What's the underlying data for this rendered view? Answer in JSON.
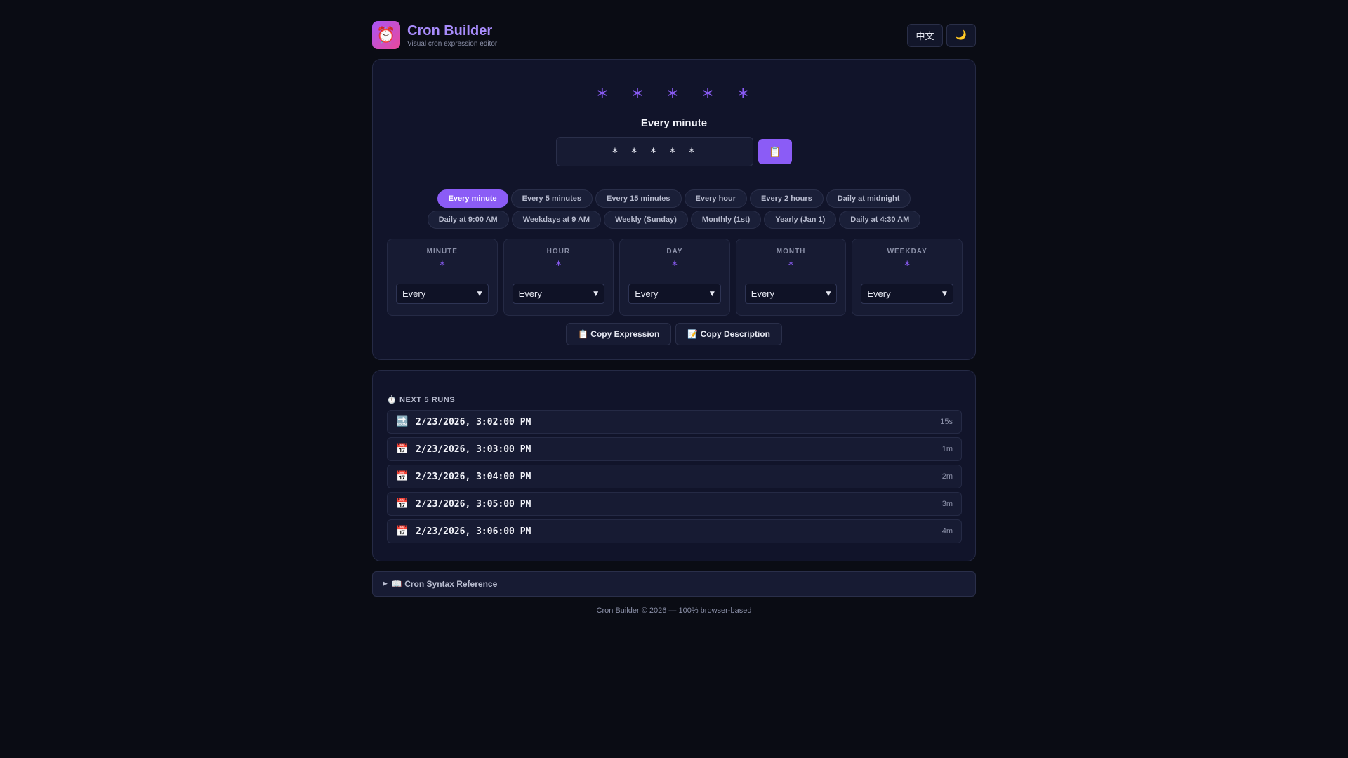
{
  "app": {
    "title": "Cron Builder",
    "subtitle": "Visual cron expression editor",
    "logo_icon": "⏰",
    "lang_label": "中文",
    "theme_icon": "🌙"
  },
  "expression": {
    "display": "* * * * *",
    "description": "Every minute",
    "input_value": "* * * * *",
    "copy_icon": "📋"
  },
  "presets": [
    {
      "label": "Every minute",
      "active": true
    },
    {
      "label": "Every 5 minutes"
    },
    {
      "label": "Every 15 minutes"
    },
    {
      "label": "Every hour"
    },
    {
      "label": "Every 2 hours"
    },
    {
      "label": "Daily at midnight"
    },
    {
      "label": "Daily at 9:00 AM"
    },
    {
      "label": "Weekdays at 9 AM"
    },
    {
      "label": "Weekly (Sunday)"
    },
    {
      "label": "Monthly (1st)"
    },
    {
      "label": "Yearly (Jan 1)"
    },
    {
      "label": "Daily at 4:30 AM"
    }
  ],
  "fields": [
    {
      "label": "MINUTE",
      "value": "*",
      "select": "Every"
    },
    {
      "label": "HOUR",
      "value": "*",
      "select": "Every"
    },
    {
      "label": "DAY",
      "value": "*",
      "select": "Every"
    },
    {
      "label": "MONTH",
      "value": "*",
      "select": "Every"
    },
    {
      "label": "WEEKDAY",
      "value": "*",
      "select": "Every"
    }
  ],
  "actions": {
    "copy_expression": "📋 Copy Expression",
    "copy_description": "📝 Copy Description"
  },
  "runs": {
    "title": "⏱️ NEXT 5 RUNS",
    "items": [
      {
        "icon": "🔜",
        "time": "2/23/2026, 3:02:00 PM",
        "relative": "15s"
      },
      {
        "icon": "📅",
        "time": "2/23/2026, 3:03:00 PM",
        "relative": "1m"
      },
      {
        "icon": "📅",
        "time": "2/23/2026, 3:04:00 PM",
        "relative": "2m"
      },
      {
        "icon": "📅",
        "time": "2/23/2026, 3:05:00 PM",
        "relative": "3m"
      },
      {
        "icon": "📅",
        "time": "2/23/2026, 3:06:00 PM",
        "relative": "4m"
      }
    ]
  },
  "reference": {
    "label": "📖 Cron Syntax Reference"
  },
  "footer": "Cron Builder © 2026 — 100% browser-based",
  "colors": {
    "accent": "#8b5cf6",
    "background": "#0a0c14",
    "card": "#11142a"
  }
}
